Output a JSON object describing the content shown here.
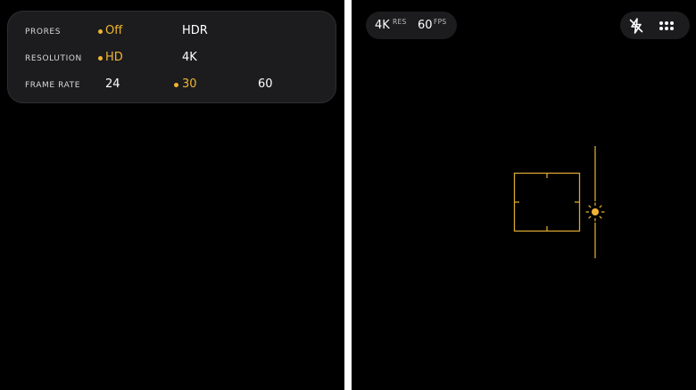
{
  "settings": {
    "prores": {
      "label": "PRORES",
      "options": [
        "Off",
        "HDR"
      ],
      "selected": "Off"
    },
    "resolution": {
      "label": "RESOLUTION",
      "options": [
        "HD",
        "4K"
      ],
      "selected": "HD"
    },
    "frame_rate": {
      "label": "FRAME RATE",
      "options": [
        "24",
        "30",
        "60"
      ],
      "selected": "30"
    }
  },
  "status": {
    "resolution_value": "4K",
    "resolution_unit": "RES",
    "fps_value": "60",
    "fps_unit": "FPS"
  },
  "icons": {
    "flash": "flash-off-icon",
    "more": "more-grid-icon",
    "exposure": "sun-exposure-icon"
  },
  "colors": {
    "accent": "#f0b532",
    "panel": "#1c1c1e",
    "background": "#000000"
  }
}
